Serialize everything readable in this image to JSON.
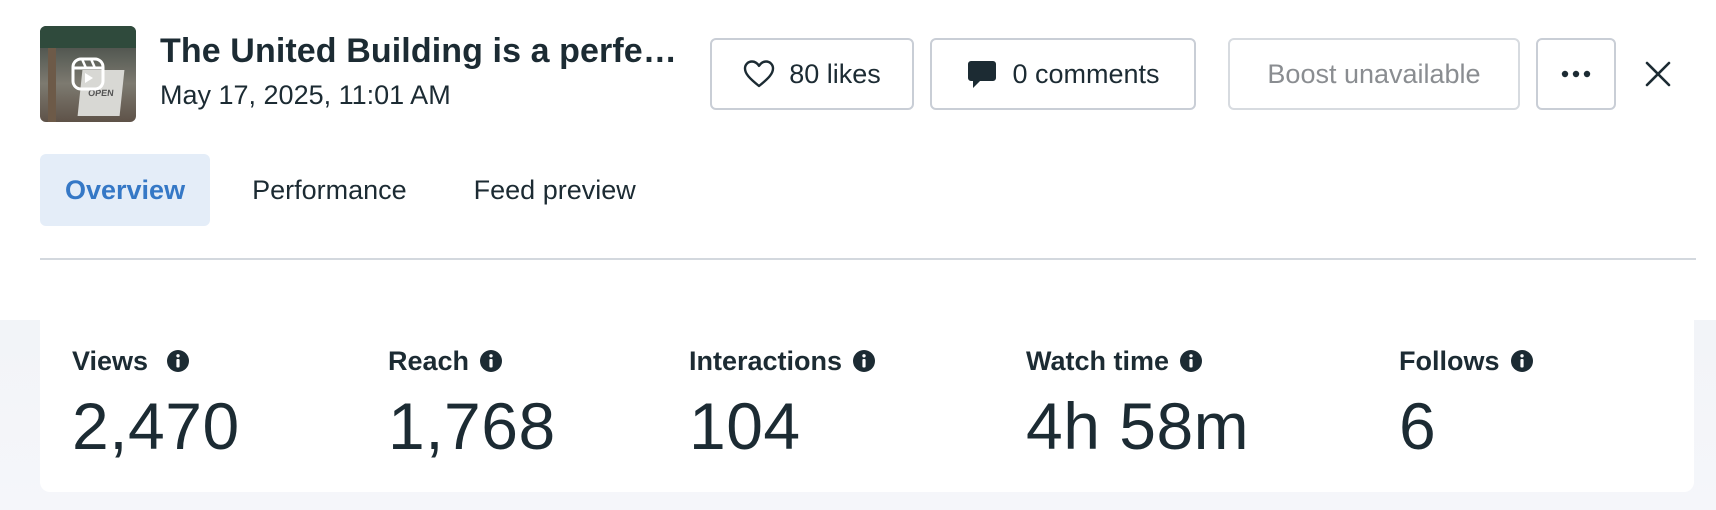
{
  "post": {
    "title": "The United Building is a perfe…",
    "date": "May 17, 2025, 11:01 AM",
    "thumbnail_icon": "reel-icon"
  },
  "actions": {
    "likes_label": "80 likes",
    "comments_label": "0 comments",
    "boost_label": "Boost unavailable",
    "more_icon": "more-icon",
    "close_icon": "close-icon"
  },
  "tabs": [
    {
      "label": "Overview",
      "active": true
    },
    {
      "label": "Performance",
      "active": false
    },
    {
      "label": "Feed preview",
      "active": false
    }
  ],
  "metrics": [
    {
      "label": "Views",
      "value": "2,470"
    },
    {
      "label": "Reach",
      "value": "1,768"
    },
    {
      "label": "Interactions",
      "value": "104"
    },
    {
      "label": "Watch time",
      "value": "4h 58m"
    },
    {
      "label": "Follows",
      "value": "6"
    }
  ],
  "colors": {
    "text": "#1c2b33",
    "accent": "#3578c6",
    "active_tab_bg": "#e4edf8",
    "border": "#c9ced6",
    "disabled_text": "#8a8d91"
  }
}
